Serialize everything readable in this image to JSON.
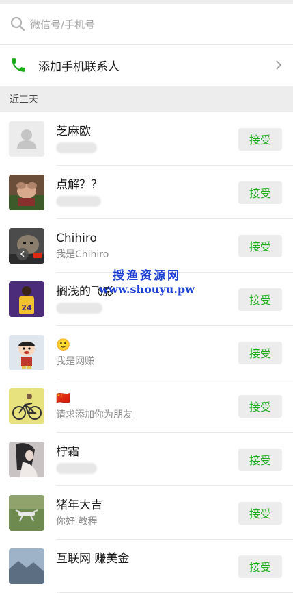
{
  "search": {
    "placeholder": "微信号/手机号"
  },
  "add_contact": {
    "label": "添加手机联系人"
  },
  "section": {
    "title": "近三天"
  },
  "requests": [
    {
      "name": "芝麻欧",
      "message": "",
      "button": "接受",
      "avatar": "default-avatar"
    },
    {
      "name": "点解？？",
      "message": "",
      "button": "接受",
      "avatar": "doll-avatar"
    },
    {
      "name": "Chihiro",
      "message": "我是Chihiro",
      "button": "接受",
      "avatar": "dog-avatar"
    },
    {
      "name": "搁浅的飞影",
      "message": "",
      "button": "接受",
      "avatar": "basketball-avatar"
    },
    {
      "name": "🙂",
      "message": "我是网赚",
      "button": "接受",
      "avatar": "cartoon-avatar"
    },
    {
      "name": "🇨🇳",
      "message": "请求添加你为朋友",
      "button": "接受",
      "avatar": "bicycle-avatar"
    },
    {
      "name": "柠霜",
      "message": "",
      "button": "接受",
      "avatar": "girl-avatar"
    },
    {
      "name": "猪年大吉",
      "message": "你好 教程",
      "button": "接受",
      "avatar": "drone-avatar"
    },
    {
      "name": "互联网 赚美金",
      "message": "",
      "button": "接受",
      "avatar": "landscape-avatar"
    }
  ],
  "watermark": {
    "line1": "授渔资源网",
    "line2": "www.shouyu.pw"
  },
  "colors": {
    "accent": "#1aad19",
    "watermark": "#1c3fd6",
    "section_bg": "#ededed"
  }
}
